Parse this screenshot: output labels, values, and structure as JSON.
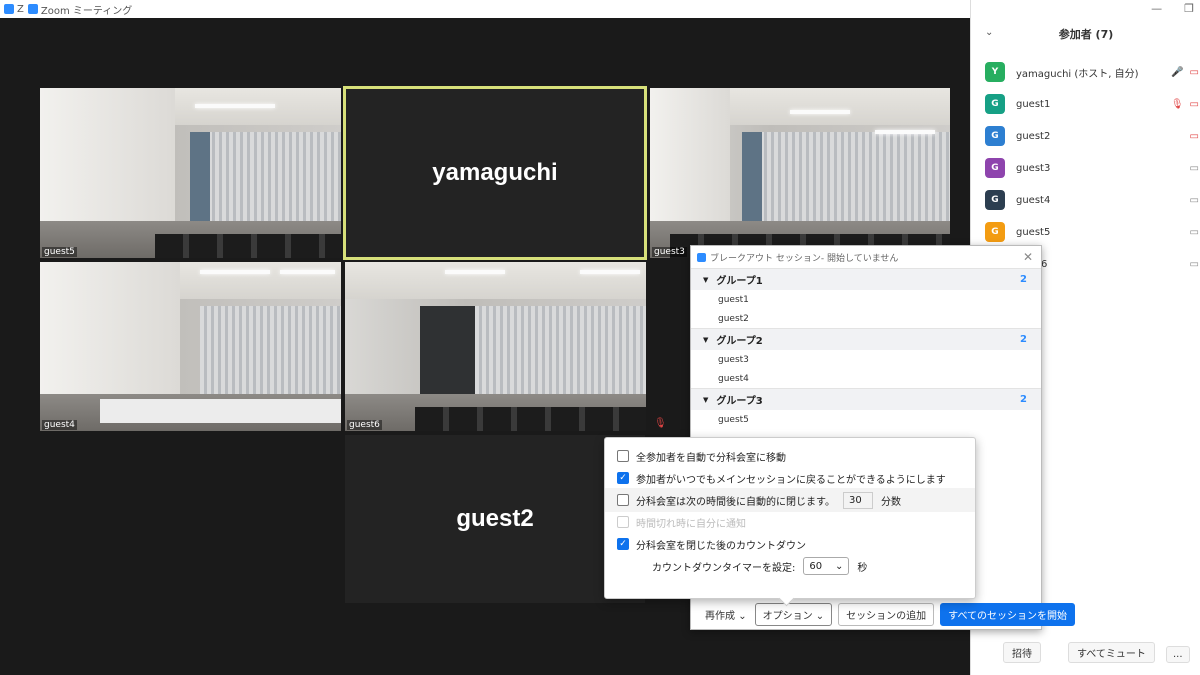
{
  "window": {
    "app_abbr": "Z",
    "title": "Zoom ミーティング"
  },
  "tiles": {
    "t1_name": "guest5",
    "t2_name": "yamaguchi",
    "t3_name": "guest3",
    "t4_name": "guest4",
    "t5_name": "guest6",
    "t6_name": "guest2"
  },
  "participants": {
    "header": "参加者 (7)",
    "items": [
      {
        "initial": "Y",
        "name": "yamaguchi (ホスト, 自分)",
        "color": "#27ae60"
      },
      {
        "initial": "G",
        "name": "guest1",
        "color": "#16a085"
      },
      {
        "initial": "G",
        "name": "guest2",
        "color": "#2d7fd1"
      },
      {
        "initial": "G",
        "name": "guest3",
        "color": "#8e44ad"
      },
      {
        "initial": "G",
        "name": "guest4",
        "color": "#2c3e50"
      },
      {
        "initial": "G",
        "name": "guest5",
        "color": "#f39c12"
      }
    ],
    "partial_text": "6",
    "invite_label": "招待",
    "mute_all_label": "すべてミュート",
    "more_label": "..."
  },
  "breakout": {
    "title": "ブレークアウト セッション- 開始していません",
    "groups": [
      {
        "name": "グループ1",
        "count": "2",
        "members": [
          "guest1",
          "guest2"
        ]
      },
      {
        "name": "グループ2",
        "count": "2",
        "members": [
          "guest3",
          "guest4"
        ]
      },
      {
        "name": "グループ3",
        "count": "2",
        "members": [
          "guest5"
        ]
      }
    ],
    "recreate_label": "再作成",
    "options_label": "オプション",
    "add_session_label": "セッションの追加",
    "start_all_label": "すべてのセッションを開始"
  },
  "options": {
    "auto_move": "全参加者を自動で分科会室に移動",
    "return_anytime": "参加者がいつでもメインセッションに戻ることができるようにします",
    "auto_close_prefix": "分科会室は次の時間後に自動的に閉じます。",
    "auto_close_value": "30",
    "auto_close_unit": "分数",
    "notify_timeout": "時間切れ時に自分に通知",
    "countdown": "分科会室を閉じた後のカウントダウン",
    "countdown_timer_label": "カウントダウンタイマーを設定:",
    "countdown_value": "60",
    "countdown_unit": "秒"
  }
}
